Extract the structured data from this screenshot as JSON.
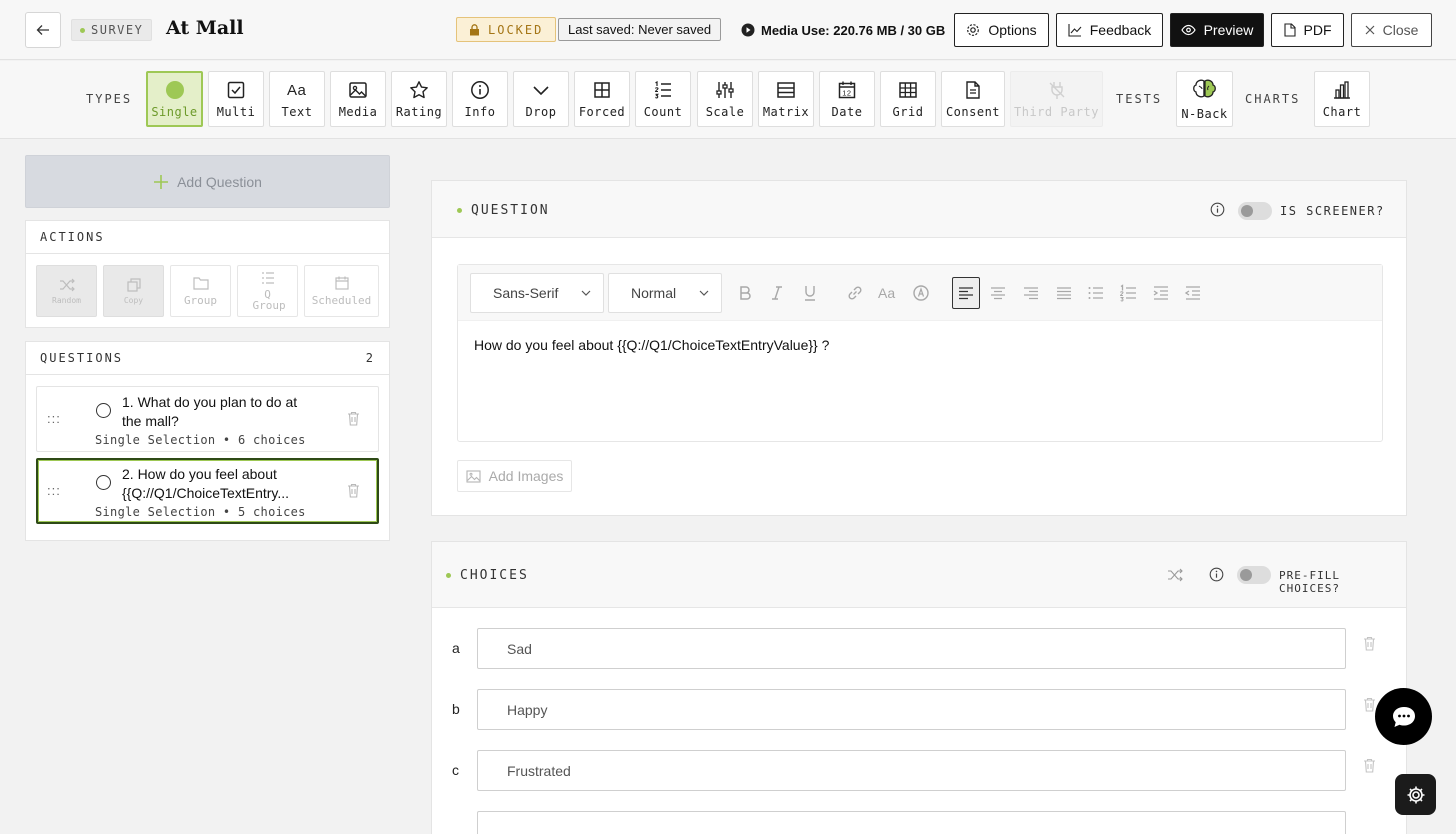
{
  "header": {
    "survey_tag": "SURVEY",
    "title": "At Mall",
    "locked": "LOCKED",
    "last_saved": "Last saved: Never saved",
    "media_use": "Media Use: 220.76 MB / 30 GB",
    "buttons": {
      "options": "Options",
      "feedback": "Feedback",
      "preview": "Preview",
      "pdf": "PDF",
      "close": "Close"
    }
  },
  "toolbar": {
    "types_label": "TYPES",
    "tests_label": "TESTS",
    "charts_label": "CHARTS",
    "types": [
      {
        "label": "Single",
        "icon": "single-circle-icon",
        "active": true
      },
      {
        "label": "Multi",
        "icon": "checkbox-icon"
      },
      {
        "label": "Text",
        "icon": "text-aa-icon"
      },
      {
        "label": "Media",
        "icon": "image-icon"
      },
      {
        "label": "Rating",
        "icon": "star-icon"
      },
      {
        "label": "Info",
        "icon": "info-icon"
      },
      {
        "label": "Drop",
        "icon": "chevron-down-icon"
      },
      {
        "label": "Forced",
        "icon": "forced-grid-icon"
      },
      {
        "label": "Count",
        "icon": "numbered-list-icon"
      },
      {
        "label": "Scale",
        "icon": "sliders-icon"
      },
      {
        "label": "Matrix",
        "icon": "matrix-icon"
      },
      {
        "label": "Date",
        "icon": "calendar-icon",
        "date_num": "12"
      },
      {
        "label": "Grid",
        "icon": "grid-icon"
      },
      {
        "label": "Consent",
        "icon": "document-icon"
      },
      {
        "label": "Third Party",
        "icon": "plug-icon",
        "disabled": true
      }
    ],
    "tests": [
      {
        "label": "N-Back",
        "icon": "brain-icon"
      }
    ],
    "charts": [
      {
        "label": "Chart",
        "icon": "bar-chart-icon"
      }
    ]
  },
  "sidebar": {
    "add_question": "Add Question",
    "actions_label": "ACTIONS",
    "actions": [
      {
        "label": "Random",
        "icon": "shuffle-icon"
      },
      {
        "label": "Copy",
        "icon": "copy-icon"
      },
      {
        "label": "Group",
        "icon": "folder-icon"
      },
      {
        "label": "Q Group",
        "icon": "list-group-icon"
      },
      {
        "label": "Scheduled",
        "icon": "calendar-icon"
      }
    ],
    "questions_label": "QUESTIONS",
    "questions_count": "2",
    "questions": [
      {
        "line1": "1. What do you plan to do at",
        "line2": "the mall?",
        "meta": "Single Selection • 6 choices"
      },
      {
        "line1": "2. How do you feel about",
        "line2": "{{Q://Q1/ChoiceTextEntry...",
        "meta": "Single Selection • 5 choices"
      }
    ]
  },
  "question_card": {
    "title": "QUESTION",
    "screener_label": "IS SCREENER?",
    "font_select": "Sans-Serif",
    "size_select": "Normal",
    "text": "How do you feel about {{Q://Q1/ChoiceTextEntryValue}} ?",
    "add_images": "Add Images"
  },
  "choices_card": {
    "title": "CHOICES",
    "prefill_label": "PRE-FILL CHOICES?",
    "choices": [
      {
        "letter": "a",
        "value": "Sad"
      },
      {
        "letter": "b",
        "value": "Happy"
      },
      {
        "letter": "c",
        "value": "Frustrated"
      }
    ]
  },
  "colors": {
    "accent": "#9ec855",
    "locked_bg": "#fbf0d6",
    "locked_text": "#a47515",
    "dark": "#111111"
  }
}
